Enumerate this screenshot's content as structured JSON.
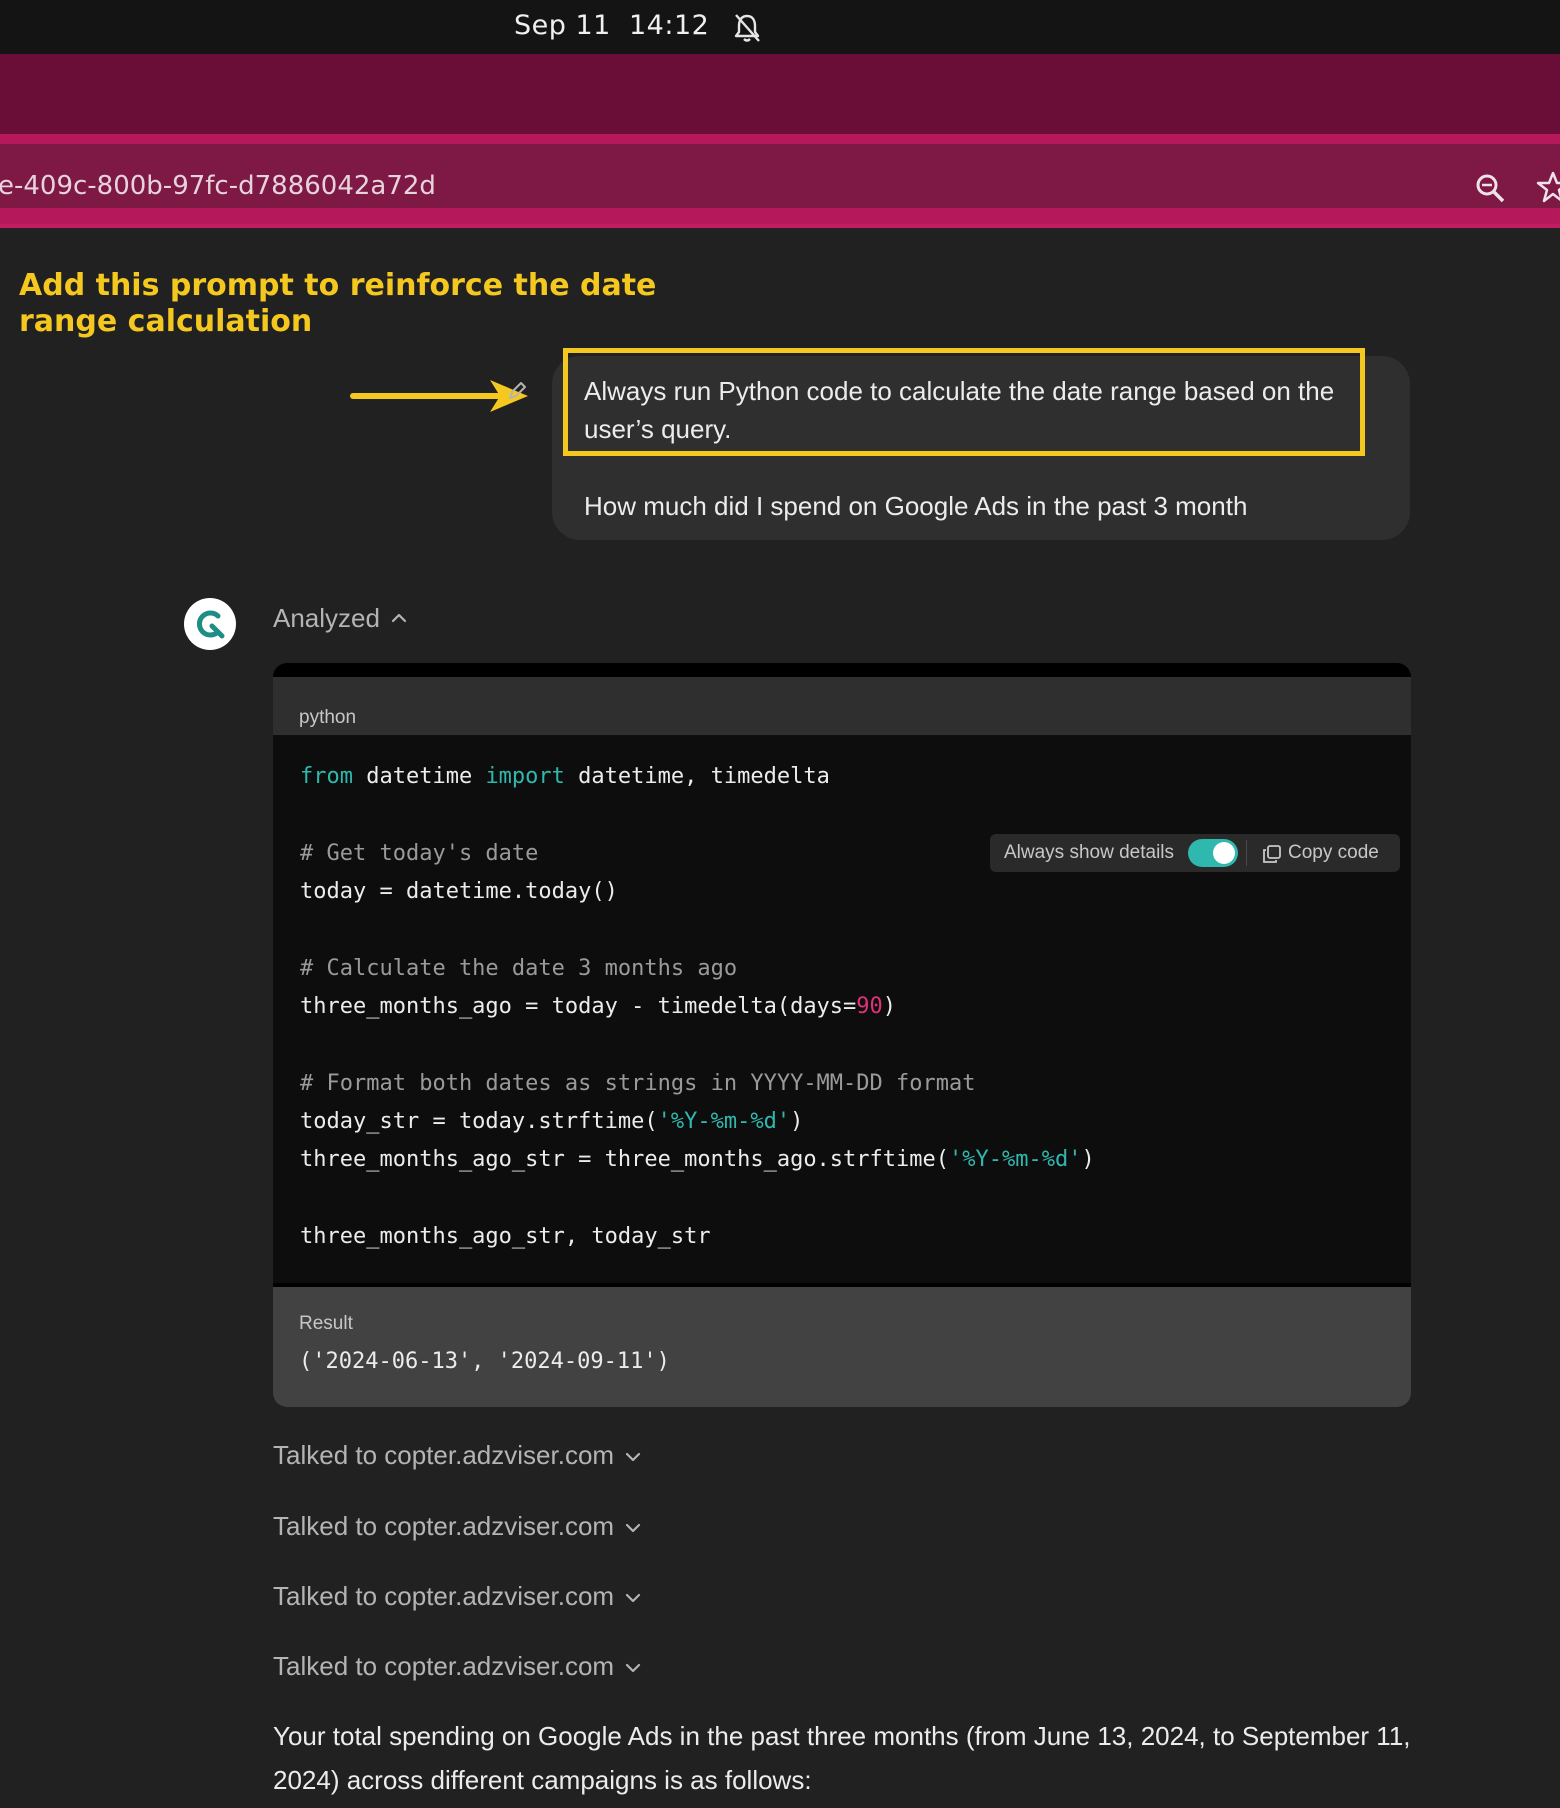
{
  "system_bar": {
    "date": "Sep 11",
    "time": "14:12",
    "icons": [
      "bell-muted-icon"
    ]
  },
  "browser": {
    "url_fragment": "e-409c-800b-97fc-d7886042a72d",
    "icons": [
      "zoom-icon",
      "bookmark-star-icon"
    ],
    "colors": {
      "tab_strip": "#6b0e37",
      "address_bar": "#b5195b",
      "address_field": "#7e1844"
    }
  },
  "annotation": {
    "title": "Add this prompt to reinforce the date range calculation",
    "color": "#f4c81f"
  },
  "user_message": {
    "highlighted_text": "Always run Python code to calculate the date range based on the user’s query.",
    "question": "How much did I spend on Google Ads in the past 3 month"
  },
  "assistant": {
    "status_label": "Analyzed",
    "code_block": {
      "language": "python",
      "always_show_details_label": "Always show details",
      "always_show_details_on": true,
      "copy_label": "Copy code",
      "lines": [
        "from datetime import datetime, timedelta",
        "",
        "# Get today's date",
        "today = datetime.today()",
        "",
        "# Calculate the date 3 months ago",
        "three_months_ago = today - timedelta(days=90)",
        "",
        "# Format both dates as strings in YYYY-MM-DD format",
        "today_str = today.strftime('%Y-%m-%d')",
        "three_months_ago_str = three_months_ago.strftime('%Y-%m-%d')",
        "",
        "three_months_ago_str, today_str"
      ]
    },
    "result": {
      "label": "Result",
      "value": "('2024-06-13', '2024-09-11')"
    },
    "tool_calls": [
      "Talked to copter.adzviser.com",
      "Talked to copter.adzviser.com",
      "Talked to copter.adzviser.com",
      "Talked to copter.adzviser.com"
    ],
    "answer": "Your total spending on Google Ads in the past three months (from June 13, 2024, to September 11, 2024) across different campaigns is as follows:"
  }
}
